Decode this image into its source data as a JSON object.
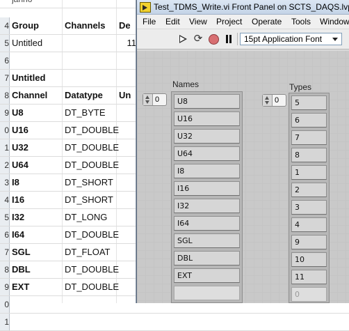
{
  "sheet": {
    "top_partial": "jahno",
    "rows": [
      {
        "num": "4",
        "a": "Group",
        "b": "Channels",
        "c": "De",
        "bold": true
      },
      {
        "num": "5",
        "a": "Untitled",
        "b": "11",
        "c": "",
        "bold": false,
        "b_num": true
      },
      {
        "num": "6",
        "a": "",
        "b": "",
        "c": "",
        "bold": false
      },
      {
        "num": "7",
        "a": "Untitled",
        "b": "",
        "c": "",
        "bold": true
      },
      {
        "num": "8",
        "a": "Channel",
        "b": "Datatype",
        "c": "Un",
        "bold": true
      },
      {
        "num": "9",
        "a": "U8",
        "b": "DT_BYTE",
        "c": "",
        "bold": true
      },
      {
        "num": "0",
        "a": "U16",
        "b": "DT_DOUBLE",
        "c": "",
        "bold": true
      },
      {
        "num": "1",
        "a": "U32",
        "b": "DT_DOUBLE",
        "c": "",
        "bold": true
      },
      {
        "num": "2",
        "a": "U64",
        "b": "DT_DOUBLE",
        "c": "",
        "bold": true
      },
      {
        "num": "3",
        "a": "I8",
        "b": "DT_SHORT",
        "c": "",
        "bold": true
      },
      {
        "num": "4",
        "a": "I16",
        "b": "DT_SHORT",
        "c": "",
        "bold": true
      },
      {
        "num": "5",
        "a": "I32",
        "b": "DT_LONG",
        "c": "",
        "bold": true
      },
      {
        "num": "6",
        "a": "I64",
        "b": "DT_DOUBLE",
        "c": "",
        "bold": true
      },
      {
        "num": "7",
        "a": "SGL",
        "b": "DT_FLOAT",
        "c": "",
        "bold": true
      },
      {
        "num": "8",
        "a": "DBL",
        "b": "DT_DOUBLE",
        "c": "",
        "bold": true
      },
      {
        "num": "9",
        "a": "EXT",
        "b": "DT_DOUBLE",
        "c": "",
        "bold": true
      },
      {
        "num": "0",
        "a": "",
        "b": "",
        "c": "",
        "bold": false
      },
      {
        "num": "1",
        "a": "",
        "b": "",
        "c": "",
        "bold": false
      }
    ]
  },
  "window": {
    "title": "Test_TDMS_Write.vi Front Panel on SCTS_DAQS.lvproj",
    "menu": [
      "File",
      "Edit",
      "View",
      "Project",
      "Operate",
      "Tools",
      "Window"
    ],
    "font_select": "15pt Application Font",
    "icons": {
      "run": "run-arrow-icon",
      "run_continuous": "run-continuously-icon",
      "abort": "abort-icon",
      "pause": "pause-icon"
    }
  },
  "names_array": {
    "label": "Names",
    "index": "0",
    "items": [
      "U8",
      "U16",
      "U32",
      "U64",
      "I8",
      "I16",
      "I32",
      "I64",
      "SGL",
      "DBL",
      "EXT",
      ""
    ]
  },
  "types_array": {
    "label": "Types",
    "index": "0",
    "items": [
      "5",
      "6",
      "7",
      "8",
      "1",
      "2",
      "3",
      "4",
      "9",
      "10",
      "11",
      "0"
    ]
  }
}
